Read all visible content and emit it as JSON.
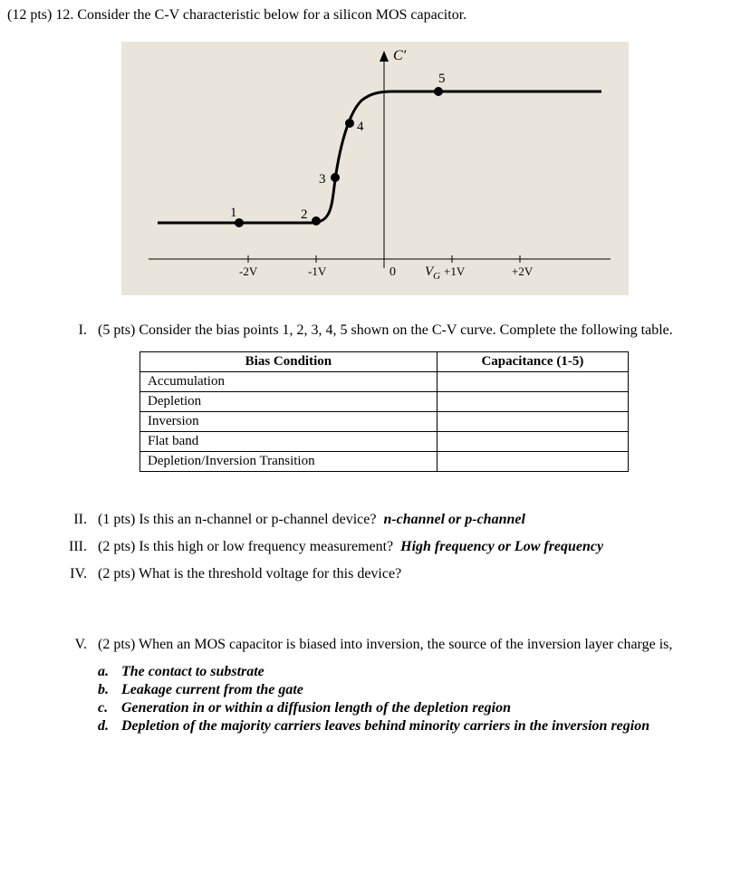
{
  "header": {
    "points": "(12 pts) 12.",
    "text": "Consider the C-V characteristic below for a silicon MOS capacitor."
  },
  "chart_data": {
    "type": "line",
    "title": "",
    "xlabel": "V_G",
    "ylabel": "C'",
    "x_ticks": [
      "-2V",
      "-1V",
      "0",
      "+1V",
      "+2V"
    ],
    "y_axis_label": "C'",
    "points": [
      {
        "label": "1",
        "x": -2.2,
        "y": 0.35
      },
      {
        "label": "2",
        "x": -1.0,
        "y": 0.35
      },
      {
        "label": "3",
        "x": -0.7,
        "y": 0.55
      },
      {
        "label": "4",
        "x": -0.4,
        "y": 0.78
      },
      {
        "label": "5",
        "x": 0.6,
        "y": 0.9
      }
    ],
    "curve_description": "S-curve rising from low C at negative VG to high C at positive VG"
  },
  "parts": {
    "I": {
      "roman": "I.",
      "pts": "(5 pts)",
      "text": "Consider the bias points 1, 2, 3, 4, 5 shown on the C-V curve.  Complete the following table.",
      "table": {
        "headers": [
          "Bias Condition",
          "Capacitance (1-5)"
        ],
        "rows": [
          [
            "Accumulation",
            ""
          ],
          [
            "Depletion",
            ""
          ],
          [
            "Inversion",
            ""
          ],
          [
            "Flat band",
            ""
          ],
          [
            "Depletion/Inversion Transition",
            ""
          ]
        ]
      }
    },
    "II": {
      "roman": "II.",
      "pts": "(1 pts)",
      "text": "Is this an n-channel or p-channel device?",
      "answer_hint": "n-channel or p-channel"
    },
    "III": {
      "roman": "III.",
      "pts": "(2 pts)",
      "text": "Is this high or low frequency measurement?",
      "answer_hint": "High frequency or Low frequency"
    },
    "IV": {
      "roman": "IV.",
      "pts": "(2 pts)",
      "text": "What is the threshold voltage for this device?"
    },
    "V": {
      "roman": "V.",
      "pts": "(2 pts)",
      "text": "When an MOS capacitor is biased into inversion, the source of the inversion layer charge is,",
      "options": [
        {
          "letter": "a.",
          "text": "The contact to substrate"
        },
        {
          "letter": "b.",
          "text": "Leakage current from the gate"
        },
        {
          "letter": "c.",
          "text": "Generation in or within a diffusion length of the depletion region"
        },
        {
          "letter": "d.",
          "text": "Depletion of the majority carriers leaves behind minority carriers in the inversion region"
        }
      ]
    }
  }
}
